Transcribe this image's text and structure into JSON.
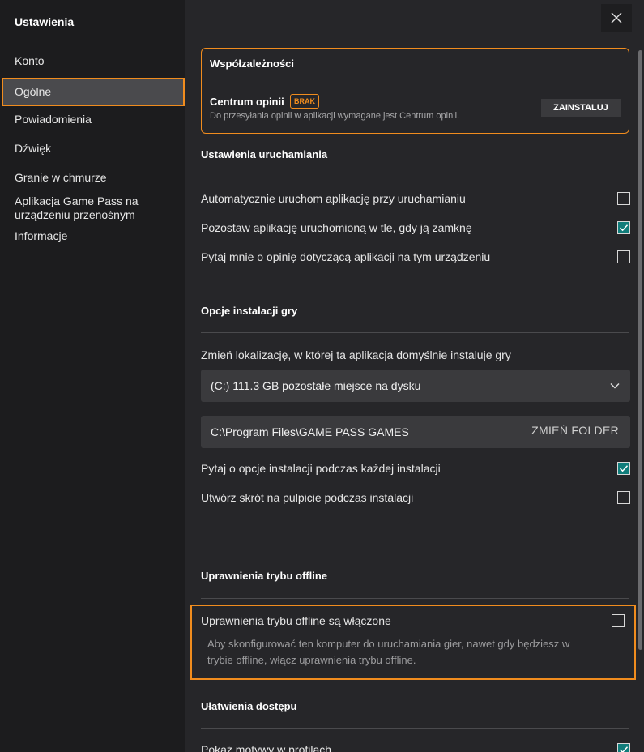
{
  "sidebar": {
    "title": "Ustawienia",
    "items": [
      {
        "label": "Konto"
      },
      {
        "label": "Ogólne"
      },
      {
        "label": "Powiadomienia"
      },
      {
        "label": "Dźwięk"
      },
      {
        "label": "Granie w chmurze"
      },
      {
        "label": "Aplikacja Game Pass na urządzeniu przenośnym"
      },
      {
        "label": "Informacje"
      }
    ],
    "selected": "Ogólne"
  },
  "dependencies": {
    "title": "Współzależności",
    "name": "Centrum opinii",
    "badge": "BRAK",
    "description": "Do przesyłania opinii w aplikacji wymagane jest Centrum opinii.",
    "install_label": "ZAINSTALUJ"
  },
  "startup": {
    "title": "Ustawienia uruchamiania",
    "options": [
      {
        "label": "Automatycznie uruchom aplikację przy uruchamianiu",
        "checked": false
      },
      {
        "label": "Pozostaw aplikację uruchomioną w tle, gdy ją zamknę",
        "checked": true
      },
      {
        "label": "Pytaj mnie o opinię dotyczącą aplikacji na tym urządzeniu",
        "checked": false
      }
    ]
  },
  "install": {
    "title": "Opcje instalacji gry",
    "location_label": "Zmień lokalizację, w której ta aplikacja domyślnie instaluje gry",
    "drive_value": "(C:) 111.3 GB pozostałe miejsce na dysku",
    "folder_path": "C:\\Program Files\\GAME PASS GAMES",
    "change_folder_label": "ZMIEŃ FOLDER",
    "options": [
      {
        "label": "Pytaj o opcje instalacji podczas każdej instalacji",
        "checked": true
      },
      {
        "label": "Utwórz skrót na pulpicie podczas instalacji",
        "checked": false
      }
    ]
  },
  "offline": {
    "title": "Uprawnienia trybu offline",
    "option_label": "Uprawnienia trybu offline są włączone",
    "checked": false,
    "description": "Aby skonfigurować ten komputer do uruchamiania gier, nawet gdy będziesz w trybie offline, włącz uprawnienia trybu offline."
  },
  "accessibility": {
    "title": "Ułatwienia dostępu",
    "options": [
      {
        "label": "Pokaż motywy w profilach",
        "checked": true
      }
    ]
  },
  "colors": {
    "accent": "#f08c1e",
    "checked": "#107c7a",
    "background": "#262629",
    "sidebar": "#1c1c1e"
  }
}
